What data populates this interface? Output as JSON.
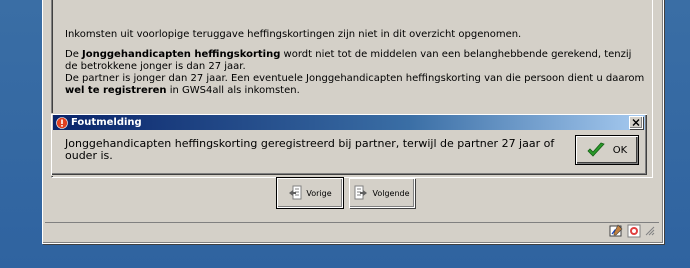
{
  "app": {
    "info": {
      "line1": "Inkomsten uit voorlopige teruggave heffingskortingen zijn niet in dit overzicht opgenomen.",
      "para2_pre": "De ",
      "para2_bold": "Jonggehandicapten heffingskorting",
      "para2_post": " wordt niet tot de middelen van een belanghebbende gerekend, tenzij de betrokkene jonger is dan 27 jaar.",
      "para3_pre": "De partner is jonger dan 27 jaar. Een eventuele Jonggehandicapten heffingskorting van die persoon dient u daarom ",
      "para3_bold": "wel te registreren",
      "para3_post": " in GWS4all als inkomsten."
    },
    "nav": {
      "previous_label": "Vorige",
      "next_label": "Volgende"
    }
  },
  "dialog": {
    "title": "Foutmelding",
    "message": "Jonggehandicapten heffingskorting geregistreerd bij partner, terwijl de partner 27 jaar of ouder is.",
    "ok_label": "OK",
    "icon": "error-icon"
  },
  "colors": {
    "desktop": "#3a6ea5",
    "window_face": "#d4d0c8",
    "title_start": "#0a246a",
    "title_end": "#a6caf0"
  }
}
